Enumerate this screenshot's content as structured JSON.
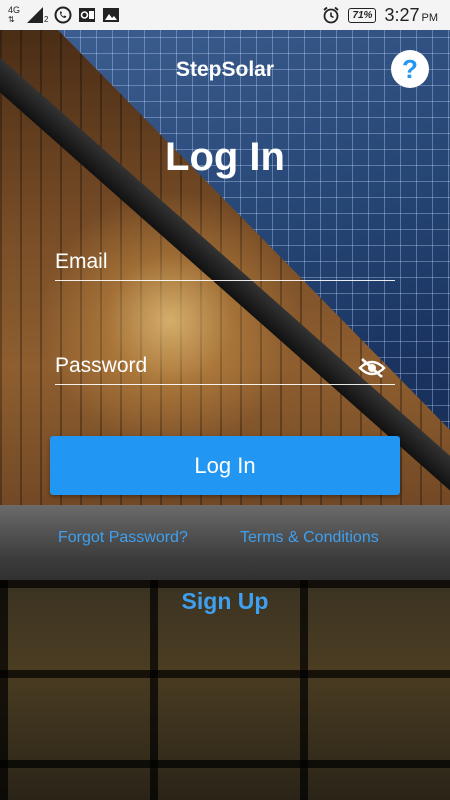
{
  "status_bar": {
    "network_type": "4G",
    "signal_subscript": "2",
    "battery": "71%",
    "time": "3:27",
    "ampm": "PM"
  },
  "header": {
    "app_title": "StepSolar",
    "help_label": "?"
  },
  "page": {
    "title": "Log In"
  },
  "form": {
    "email_placeholder": "Email",
    "email_value": "",
    "password_placeholder": "Password",
    "password_value": "",
    "login_label": "Log In"
  },
  "links": {
    "forgot_password": "Forgot Password?",
    "terms": "Terms & Conditions",
    "sign_up": "Sign Up"
  },
  "colors": {
    "accent": "#2196f3",
    "link": "#3fa0ef"
  },
  "icons": {
    "help": "question-icon",
    "password_toggle": "eye-off-icon"
  }
}
